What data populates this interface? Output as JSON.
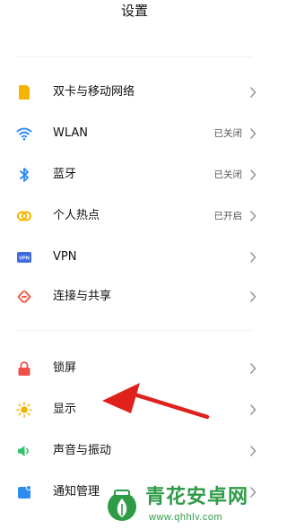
{
  "header": {
    "title": "设置"
  },
  "rows": [
    {
      "label": "双卡与移动网络",
      "status": "",
      "icon": "sim-card-icon",
      "color": "#f5b400"
    },
    {
      "label": "WLAN",
      "status": "已关闭",
      "icon": "wifi-icon",
      "color": "#2f8cf0"
    },
    {
      "label": "蓝牙",
      "status": "已关闭",
      "icon": "bluetooth-icon",
      "color": "#2f8cf0"
    },
    {
      "label": "个人热点",
      "status": "已开启",
      "icon": "hotspot-icon",
      "color": "#f5b400"
    },
    {
      "label": "VPN",
      "status": "",
      "icon": "vpn-icon",
      "color": "#3d6be0",
      "icon_text": "VPN"
    },
    {
      "label": "连接与共享",
      "status": "",
      "icon": "connection-sharing-icon",
      "color": "#ee5a3f"
    },
    {
      "label": "锁屏",
      "status": "",
      "icon": "lock-icon",
      "color": "#f0504a"
    },
    {
      "label": "显示",
      "status": "",
      "icon": "sun-icon",
      "color": "#f5b400"
    },
    {
      "label": "声音与振动",
      "status": "",
      "icon": "speaker-icon",
      "color": "#2cc46a"
    },
    {
      "label": "通知管理",
      "status": "",
      "icon": "notification-icon",
      "color": "#2f8cf0"
    }
  ],
  "annotation": {
    "color": "#e0201b"
  },
  "watermark": {
    "title": "青花安卓网",
    "url": "www.qhhlv.com",
    "color": "#2f9b47"
  }
}
